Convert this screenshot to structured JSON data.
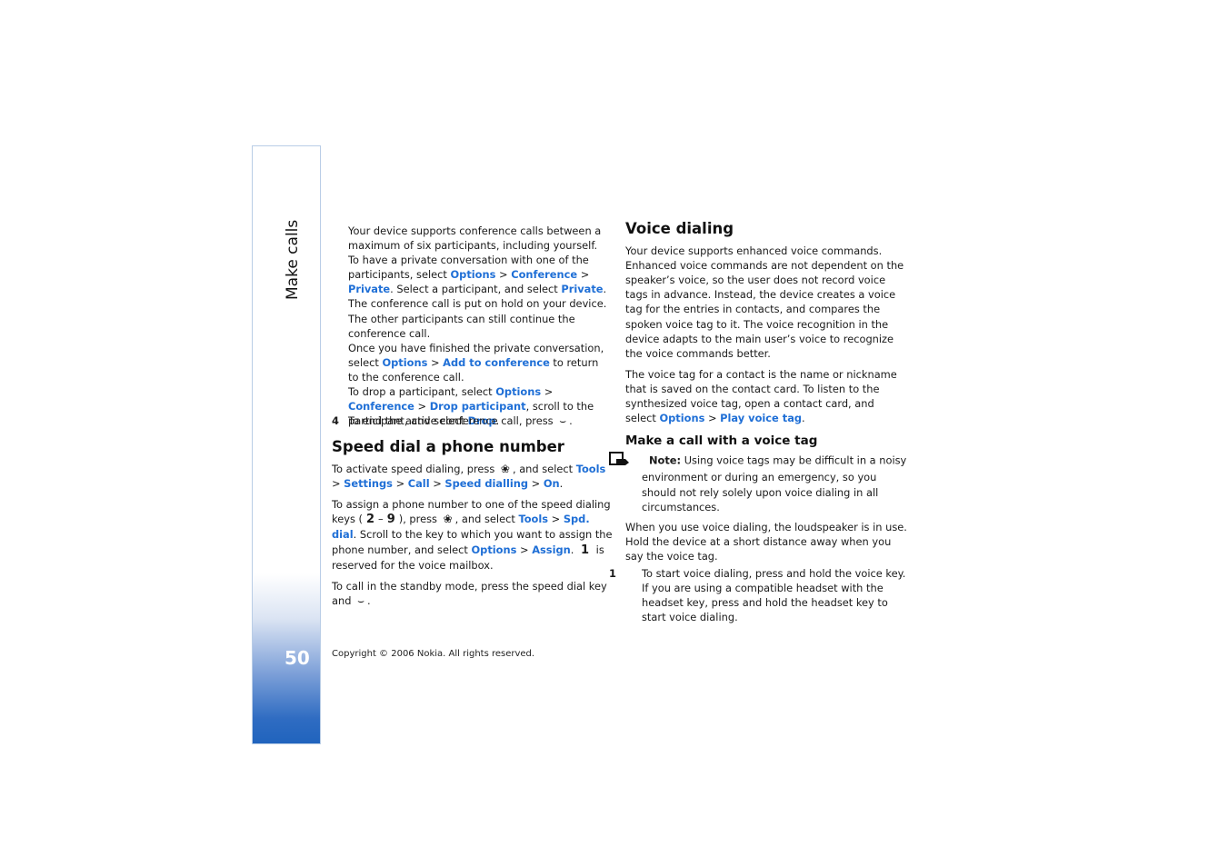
{
  "sidebar": {
    "section_title": "Make calls",
    "page_number": "50"
  },
  "left_column": {
    "intro": {
      "p1": "Your device supports conference calls between a maximum of six participants, including yourself.",
      "p2_a": "To have a private conversation with one of the participants, select ",
      "p2_options": "Options",
      "p2_sep1": " > ",
      "p2_conference": "Conference",
      "p2_sep2": " > ",
      "p2_private": "Private",
      "p2_b": ". Select a participant, and select ",
      "p2_private2": "Private",
      "p2_c": ". The conference call is put on hold on your device. The other participants can still continue the conference call.",
      "p3_a": "Once you have finished the private conversation, select ",
      "p3_options": "Options",
      "p3_sep": " > ",
      "p3_add": "Add to conference",
      "p3_b": " to return to the conference call.",
      "p4_a": "To drop a participant, select ",
      "p4_options": "Options",
      "p4_sep1": " > ",
      "p4_conference": "Conference",
      "p4_sep2": " > ",
      "p4_drop_participant": "Drop participant",
      "p4_b": ", scroll to the participant, and select ",
      "p4_drop": "Drop",
      "p4_c": "."
    },
    "step4": {
      "number": "4",
      "text": "To end the active conference call, press ",
      "icon": "end-call-icon",
      "end": "."
    },
    "speed_dial": {
      "heading": "Speed dial a phone number",
      "p1_a": "To activate speed dialing, press ",
      "p1_icon": "menu-key-icon",
      "p1_b": ", and select ",
      "p1_tools": "Tools",
      "p1_settings": "Settings",
      "p1_call": "Call",
      "p1_speed": "Speed dialling",
      "p1_on": "On",
      "sep": " > ",
      "p1_end": ".",
      "p2_a": "To assign a phone number to one of the speed dialing keys (",
      "p2_key_from": "2",
      "p2_dash": "–",
      "p2_key_to": "9",
      "p2_b": "), press ",
      "p2_c": ", and select ",
      "p2_tools": "Tools",
      "p2_spd": "Spd. dial",
      "p2_d": ". Scroll to the key to which you want to assign the phone number, and select ",
      "p2_options": "Options",
      "p2_assign": "Assign",
      "p2_e": ". ",
      "p2_key1": "1",
      "p2_f": " is reserved for the voice mailbox.",
      "p3_a": "To call in the standby mode, press the speed dial key and ",
      "p3_icon": "call-key-icon",
      "p3_end": "."
    }
  },
  "right_column": {
    "voice_dialing": {
      "heading": "Voice dialing",
      "p1": "Your device supports enhanced voice commands. Enhanced voice commands are not dependent on the speaker’s voice, so the user does not record voice tags in advance. Instead, the device creates a voice tag for the entries in contacts, and compares the spoken voice tag to it. The voice recognition in the device adapts to the main user’s voice to recognize the voice commands better.",
      "p2_a": "The voice tag for a contact is the name or nickname that is saved on the contact card. To listen to the synthesized voice tag, open a contact card, and select ",
      "p2_options": "Options",
      "p2_sep": " > ",
      "p2_play": "Play voice tag",
      "p2_end": "."
    },
    "voice_tag_call": {
      "heading": "Make a call with a voice tag",
      "note_label": "Note:",
      "note_text": " Using voice tags may be difficult in a noisy environment or during an emergency, so you should not rely solely upon voice dialing in all circumstances.",
      "p1": "When you use voice dialing, the loudspeaker is in use. Hold the device at a short distance away when you say the voice tag.",
      "step1_number": "1",
      "step1_text": "To start voice dialing, press and hold the voice key. If you are using a compatible headset with the headset key, press and hold the headset key to start voice dialing."
    }
  },
  "footer": {
    "copyright": "Copyright © 2006 Nokia. All rights reserved."
  },
  "colors": {
    "link": "#1f6fd6",
    "sidebar_border": "#b9cde6",
    "sidebar_gradient_bottom": "#1f63bd"
  }
}
